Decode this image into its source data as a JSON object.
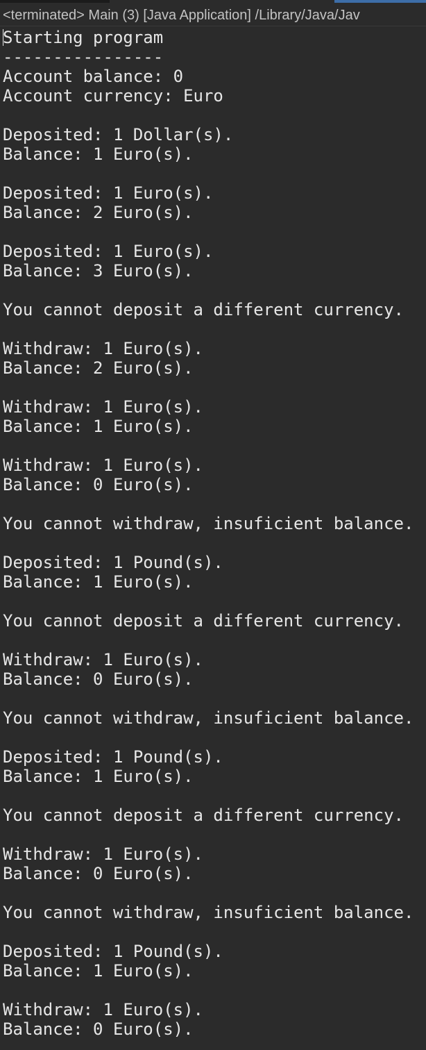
{
  "header": {
    "title": "<terminated> Main (3) [Java Application] /Library/Java/Jav"
  },
  "console": {
    "lines": [
      "Starting program",
      "----------------",
      "Account balance: 0",
      "Account currency: Euro",
      "",
      "Deposited: 1 Dollar(s).",
      "Balance: 1 Euro(s).",
      "",
      "Deposited: 1 Euro(s).",
      "Balance: 2 Euro(s).",
      "",
      "Deposited: 1 Euro(s).",
      "Balance: 3 Euro(s).",
      "",
      "You cannot deposit a different currency.",
      "",
      "Withdraw: 1 Euro(s).",
      "Balance: 2 Euro(s).",
      "",
      "Withdraw: 1 Euro(s).",
      "Balance: 1 Euro(s).",
      "",
      "Withdraw: 1 Euro(s).",
      "Balance: 0 Euro(s).",
      "",
      "You cannot withdraw, insuficient balance.",
      "",
      "Deposited: 1 Pound(s).",
      "Balance: 1 Euro(s).",
      "",
      "You cannot deposit a different currency.",
      "",
      "Withdraw: 1 Euro(s).",
      "Balance: 0 Euro(s).",
      "",
      "You cannot withdraw, insuficient balance.",
      "",
      "Deposited: 1 Pound(s).",
      "Balance: 1 Euro(s).",
      "",
      "You cannot deposit a different currency.",
      "",
      "Withdraw: 1 Euro(s).",
      "Balance: 0 Euro(s).",
      "",
      "You cannot withdraw, insuficient balance.",
      "",
      "Deposited: 1 Pound(s).",
      "Balance: 1 Euro(s).",
      "",
      "Withdraw: 1 Euro(s).",
      "Balance: 0 Euro(s)."
    ]
  }
}
